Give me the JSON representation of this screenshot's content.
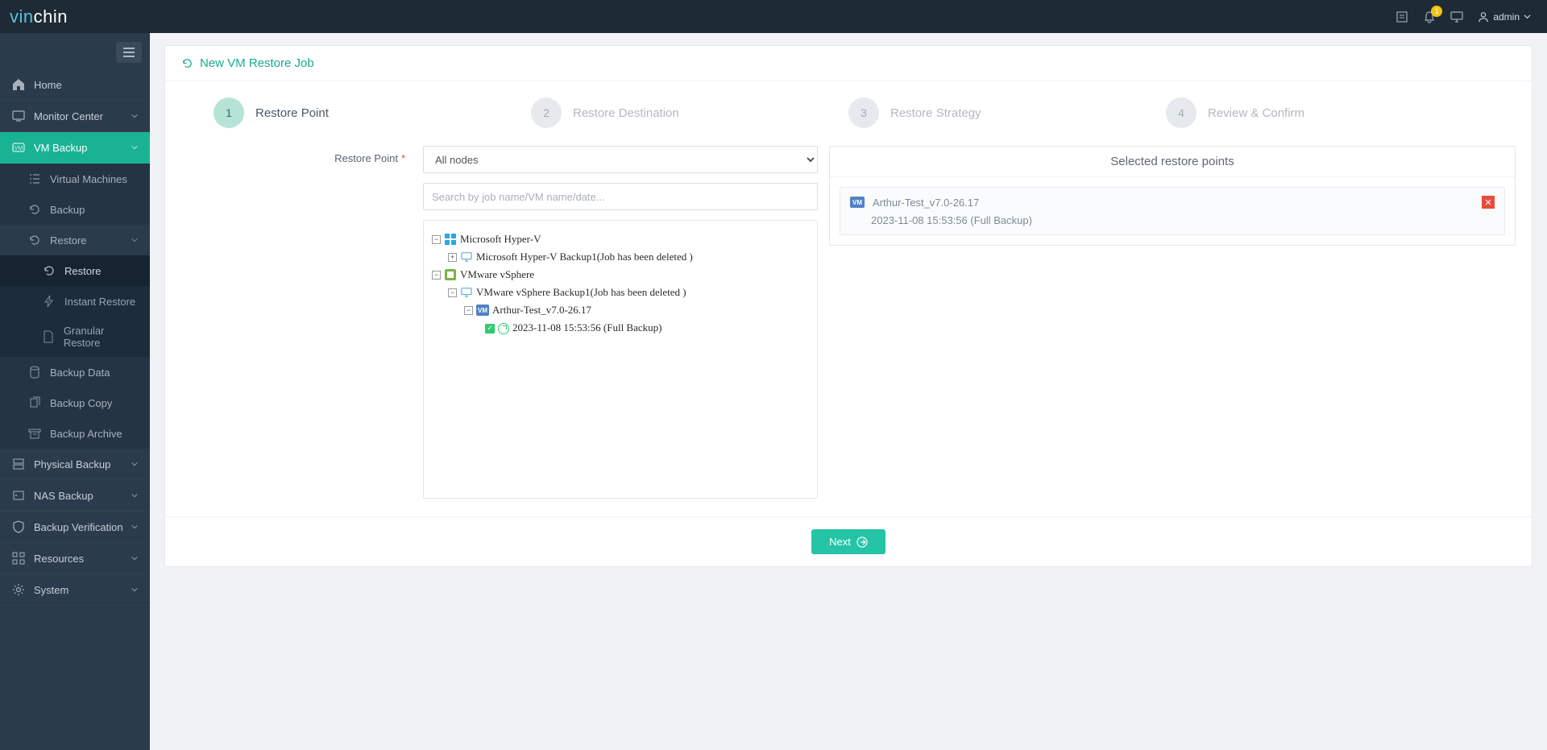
{
  "brand": {
    "prefix": "vin",
    "suffix": "chin"
  },
  "header": {
    "notification_count": "1",
    "user_name": "admin"
  },
  "sidebar": {
    "items": {
      "home": "Home",
      "monitor": "Monitor Center",
      "vmbackup": "VM Backup",
      "physical": "Physical Backup",
      "nas": "NAS Backup",
      "verification": "Backup Verification",
      "resources": "Resources",
      "system": "System"
    },
    "vm_sub": {
      "vms": "Virtual Machines",
      "backup": "Backup",
      "restore": "Restore",
      "backup_data": "Backup Data",
      "backup_copy": "Backup Copy",
      "backup_archive": "Backup Archive"
    },
    "restore_sub": {
      "restore": "Restore",
      "instant": "Instant Restore",
      "granular": "Granular Restore"
    }
  },
  "page": {
    "title": "New VM Restore Job",
    "steps": [
      "Restore Point",
      "Restore Destination",
      "Restore Strategy",
      "Review & Confirm"
    ],
    "field_label": "Restore Point",
    "node_select": "All nodes",
    "search_placeholder": "Search by job name/VM name/date...",
    "tree": {
      "hv_root": "Microsoft Hyper-V",
      "hv_job": "Microsoft Hyper-V Backup1(Job has been deleted )",
      "vs_root": "VMware vSphere",
      "vs_job": "VMware vSphere Backup1(Job has been deleted )",
      "vm_name": "Arthur-Test_v7.0-26.17",
      "restore_point": "2023-11-08 15:53:56 (Full  Backup)"
    },
    "selected_title": "Selected restore points",
    "selected_vm": "Arthur-Test_v7.0-26.17",
    "selected_time": "2023-11-08 15:53:56 (Full Backup)",
    "next_btn": "Next"
  }
}
